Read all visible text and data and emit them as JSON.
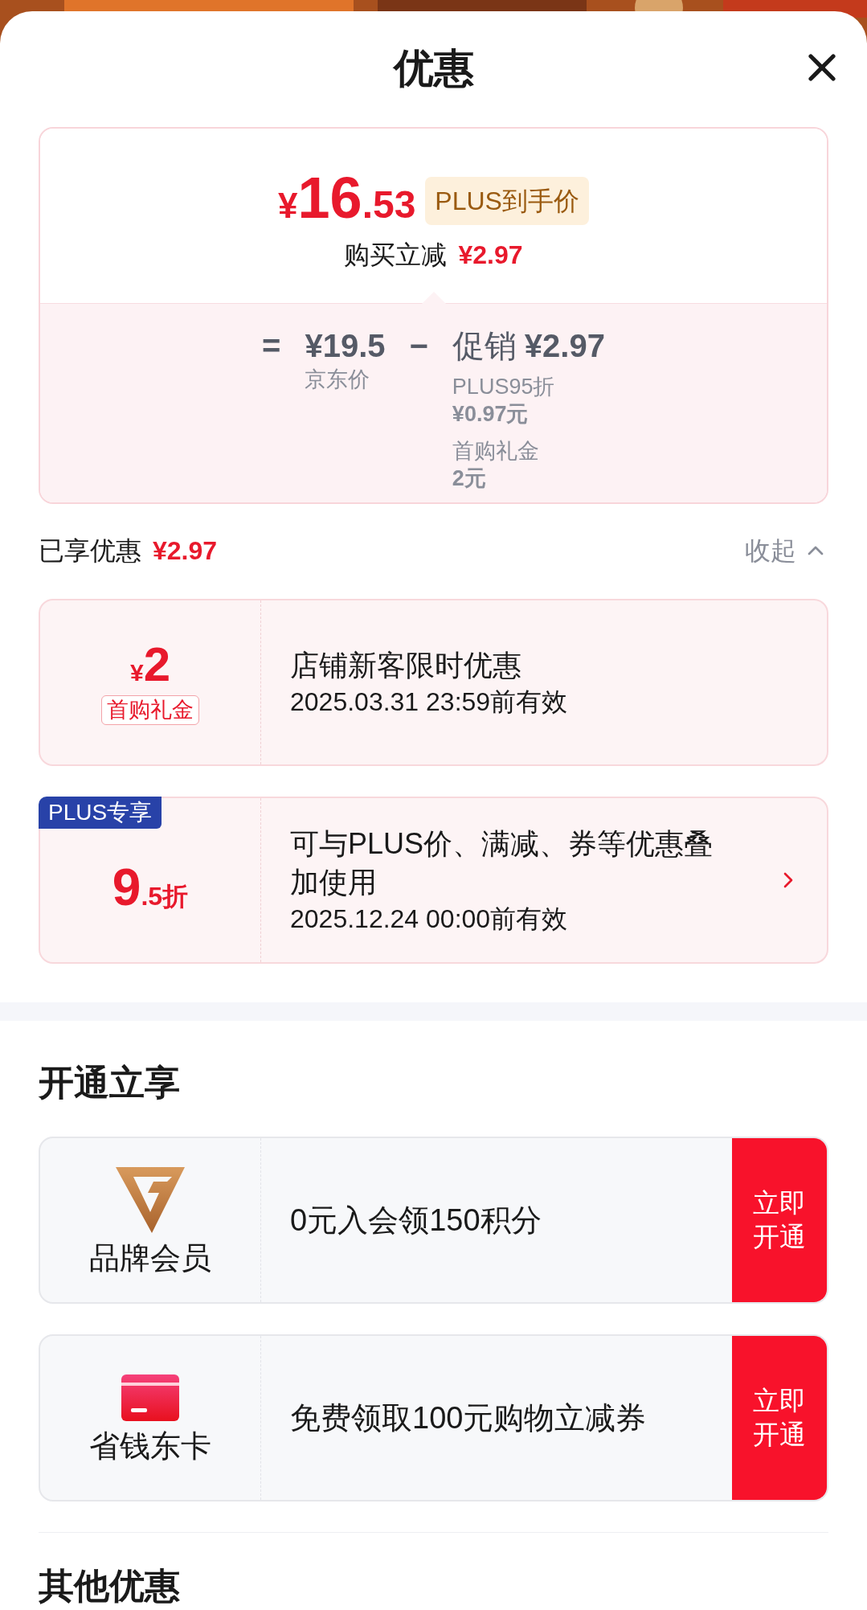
{
  "sheet": {
    "title": "优惠"
  },
  "price_summary": {
    "currency": "¥",
    "amount_int": "16",
    "amount_dec": ".53",
    "badge": "PLUS到手价",
    "reduction_label": "购买立减",
    "reduction_amount": "¥2.97",
    "breakdown": {
      "equals": "=",
      "base_price": "¥19.5",
      "base_label": "京东价",
      "minus": "−",
      "promo_label": "促销",
      "promo_amount": "¥2.97",
      "promo_items": [
        {
          "name": "PLUS95折",
          "amount": "¥0.97元"
        },
        {
          "name": "首购礼金",
          "amount": "2元"
        }
      ]
    }
  },
  "enjoyed": {
    "label": "已享优惠",
    "amount": "¥2.97",
    "toggle": "收起",
    "expanded": true
  },
  "coupons": [
    {
      "kind": "cash",
      "currency": "¥",
      "value": "2",
      "tag": "首购礼金",
      "title": "店铺新客限时优惠",
      "validity": "2025.03.31 23:59前有效",
      "has_detail": false
    },
    {
      "kind": "discount",
      "badge": "PLUS专享",
      "value": "9",
      "value_suffix": ".5折",
      "title": "可与PLUS价、满减、券等优惠叠加使用",
      "validity": "2025.12.24 00:00前有效",
      "has_detail": true
    }
  ],
  "membership": {
    "title": "开通立享",
    "offers": [
      {
        "kind": "brand",
        "name": "品牌会员",
        "text": "0元入会领150积分",
        "button": "立即开通"
      },
      {
        "kind": "card",
        "name": "省钱东卡",
        "text": "免费领取100元购物立减券",
        "button": "立即开通"
      }
    ]
  },
  "other": {
    "title": "其他优惠"
  }
}
